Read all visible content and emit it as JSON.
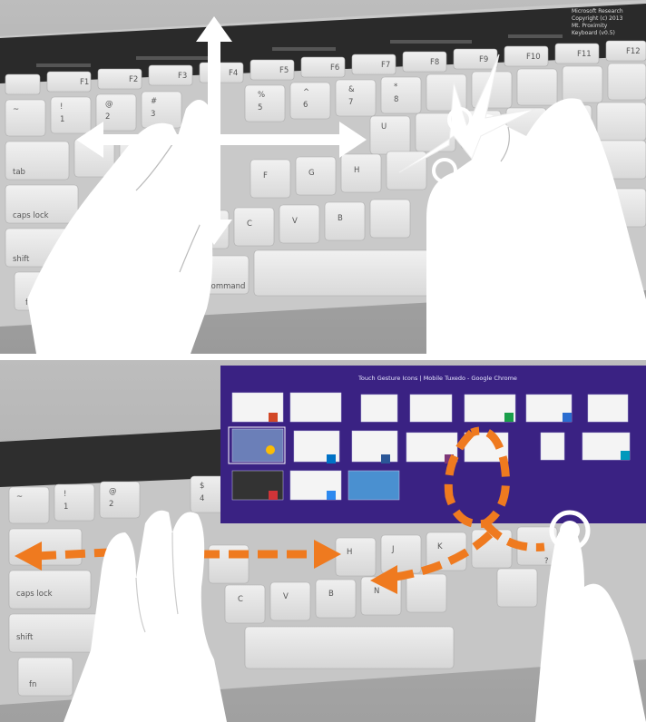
{
  "top_photo": {
    "notice_lines": [
      "Microsoft Research",
      "Copyright (c) 2013",
      "Mt. Proximity",
      "Keyboard (v0.5)"
    ],
    "key_labels": {
      "f1": "F1",
      "f2": "F2",
      "f3": "F3",
      "f4": "F4",
      "f5": "F5",
      "f6": "F6",
      "f7": "F7",
      "f8": "F8",
      "f9": "F9",
      "f10": "F10",
      "f11": "F11",
      "f12": "F12",
      "tab": "tab",
      "caps": "caps lock",
      "shift": "shift",
      "fn": "fn",
      "command": "command",
      "f": "F",
      "g": "G",
      "h": "H",
      "c": "C",
      "v": "V",
      "b": "B",
      "u": "U",
      "x": "X",
      "tilde": "~",
      "one": "1",
      "two": "2",
      "three": "3",
      "pct": "%",
      "five": "5",
      "caret": "^",
      "six": "6",
      "amp": "&",
      "seven": "7",
      "star": "*",
      "eight": "8",
      "excl": "!",
      "at": "@",
      "hash": "#"
    }
  },
  "bottom_photo": {
    "switcher_title": "Touch Gesture Icons | Mobile Tuxedo - Google Chrome",
    "key_labels": {
      "caps": "caps lock",
      "shift": "shift",
      "fn": "fn",
      "h": "H",
      "j": "J",
      "k": "K",
      "c": "C",
      "v": "V",
      "b": "B",
      "n": "N",
      "tilde": "~",
      "one": "1",
      "two": "2",
      "four": "4",
      "dollar": "$",
      "at": "@",
      "excl": "!",
      "question": "?"
    }
  },
  "colors": {
    "arrow_orange": "#ef7a1f",
    "switcher_bg": "#3a2283",
    "key_face": "#e6e6e6",
    "hand_white": "#ffffff"
  },
  "icons": [
    "hand-gesture-icon",
    "four-way-arrow-icon",
    "pinch-spread-icon",
    "swipe-arrow-icon",
    "tap-circle-icon"
  ]
}
